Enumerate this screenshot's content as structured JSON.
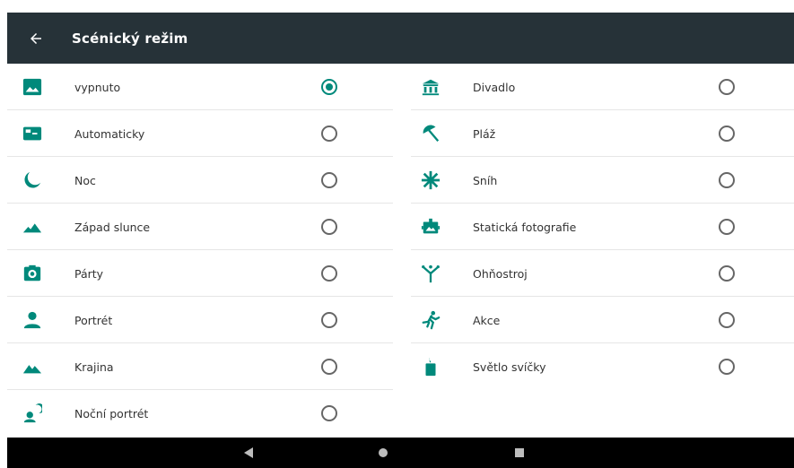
{
  "app_bar": {
    "title": "Scénický režim"
  },
  "accent_color": "#00897b",
  "left_column": [
    {
      "label": "vypnuto",
      "icon": "image-icon",
      "selected": true
    },
    {
      "label": "Automaticky",
      "icon": "auto-scene-icon",
      "selected": false
    },
    {
      "label": "Noc",
      "icon": "moon-icon",
      "selected": false
    },
    {
      "label": "Západ slunce",
      "icon": "sunset-icon",
      "selected": false
    },
    {
      "label": "Párty",
      "icon": "party-icon",
      "selected": false
    },
    {
      "label": "Portrét",
      "icon": "portrait-icon",
      "selected": false
    },
    {
      "label": "Krajina",
      "icon": "landscape-icon",
      "selected": false
    },
    {
      "label": "Noční portrét",
      "icon": "night-portrait-icon",
      "selected": false
    }
  ],
  "right_column": [
    {
      "label": "Divadlo",
      "icon": "theatre-icon",
      "selected": false
    },
    {
      "label": "Pláž",
      "icon": "beach-icon",
      "selected": false
    },
    {
      "label": "Sníh",
      "icon": "snow-icon",
      "selected": false
    },
    {
      "label": "Statická fotografie",
      "icon": "steady-photo-icon",
      "selected": false
    },
    {
      "label": "Ohňostroj",
      "icon": "fireworks-icon",
      "selected": false
    },
    {
      "label": "Akce",
      "icon": "action-icon",
      "selected": false
    },
    {
      "label": "Světlo svíčky",
      "icon": "candlelight-icon",
      "selected": false
    }
  ],
  "nav_bar": {
    "icons": [
      "back-triangle-icon",
      "home-circle-icon",
      "recents-square-icon"
    ]
  }
}
